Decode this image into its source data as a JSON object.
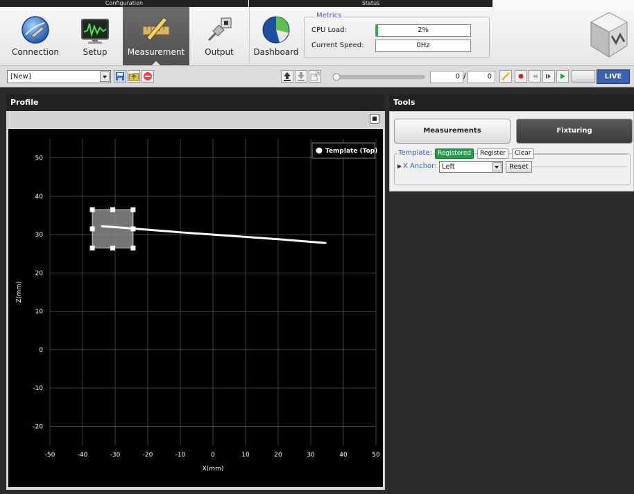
{
  "ribbon": {
    "configuration_label": "Configuration",
    "status_label": "Status",
    "buttons": [
      {
        "label": "Connection",
        "icon": "globe-wrench-icon"
      },
      {
        "label": "Setup",
        "icon": "monitor-waveform-icon"
      },
      {
        "label": "Measurement",
        "icon": "ruler-pencil-icon",
        "active": true
      },
      {
        "label": "Output",
        "icon": "plug-cable-icon"
      },
      {
        "label": "Dashboard",
        "icon": "pie-dashboard-icon"
      }
    ],
    "metrics": {
      "title": "Metrics",
      "rows": [
        {
          "label": "CPU Load:",
          "value": "2%",
          "fill_percent": 2
        },
        {
          "label": "Current Speed:",
          "value": "0Hz",
          "fill_percent": 0
        }
      ]
    }
  },
  "toolbar": {
    "job_select_value": "[New]",
    "frame_current": "0",
    "frame_total": "0",
    "live_label": "LIVE"
  },
  "profile": {
    "title": "Profile"
  },
  "chart_data": {
    "type": "line",
    "xlabel": "X(mm)",
    "ylabel": "Z(mm)",
    "xlim": [
      -50,
      50
    ],
    "ylim": [
      -25,
      55
    ],
    "x_ticks": [
      -50,
      -40,
      -30,
      -20,
      -10,
      0,
      10,
      20,
      30,
      40,
      50
    ],
    "y_ticks": [
      -20,
      -10,
      0,
      10,
      20,
      30,
      40,
      50
    ],
    "grid": true,
    "legend_position": "top-right",
    "series": [
      {
        "name": "Template (Top)",
        "color": "#ffffff",
        "x": [
          -34,
          -25,
          -10,
          0,
          10,
          20,
          34.5
        ],
        "y": [
          32.2,
          31.6,
          30.6,
          30.0,
          29.4,
          28.8,
          27.8
        ]
      }
    ],
    "selection_rect": {
      "x_min": -37,
      "x_max": -24.5,
      "y_min": 26.5,
      "y_max": 36.5
    }
  },
  "tools": {
    "title": "Tools",
    "tabs": [
      {
        "label": "Measurements"
      },
      {
        "label": "Fixturing",
        "active": true
      }
    ],
    "template_label": "Template:",
    "registered_label": "Registered",
    "register_label": "Register",
    "clear_label": "Clear",
    "x_anchor_label": "X Anchor:",
    "x_anchor_value": "Left",
    "reset_label": "Reset"
  }
}
